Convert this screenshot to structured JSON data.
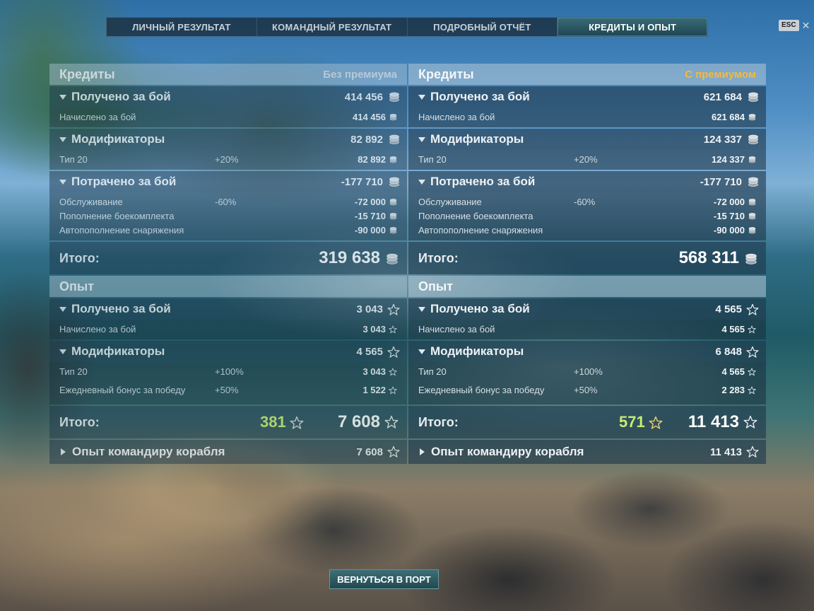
{
  "tabs": [
    {
      "label": "ЛИЧНЫЙ РЕЗУЛЬТАТ"
    },
    {
      "label": "КОМАНДНЫЙ РЕЗУЛЬТАТ"
    },
    {
      "label": "ПОДРОБНЫЙ ОТЧЁТ"
    },
    {
      "label": "КРЕДИТЫ И ОПЫТ",
      "active": true
    }
  ],
  "esc": {
    "key": "ESC",
    "close": "✕"
  },
  "icons": {
    "coin": "coin-icon",
    "star": "star-icon"
  },
  "colors": {
    "premium": "#f6b93b",
    "bonus_xp": "#c8ec70"
  },
  "left": {
    "credits": {
      "title": "Кредиты",
      "subtitle": "Без премиума",
      "earned": {
        "label": "Получено за бой",
        "value": "414 456",
        "rows": [
          {
            "label": "Начислено за бой",
            "pct": "",
            "value": "414 456"
          }
        ]
      },
      "modifiers": {
        "label": "Модификаторы",
        "value": "82 892",
        "rows": [
          {
            "label": "Тип 20",
            "pct": "+20%",
            "value": "82 892"
          }
        ]
      },
      "spent": {
        "label": "Потрачено за бой",
        "value": "-177 710",
        "rows": [
          {
            "label": "Обслуживание",
            "pct": "-60%",
            "value": "-72 000"
          },
          {
            "label": "Пополнение боекомплекта",
            "pct": "",
            "value": "-15 710"
          },
          {
            "label": "Автопополнение снаряжения",
            "pct": "",
            "value": "-90 000"
          }
        ]
      },
      "total": {
        "label": "Итого:",
        "value": "319 638"
      }
    },
    "xp": {
      "title": "Опыт",
      "earned": {
        "label": "Получено за бой",
        "value": "3 043",
        "rows": [
          {
            "label": "Начислено за бой",
            "pct": "",
            "value": "3 043"
          }
        ]
      },
      "modifiers": {
        "label": "Модификаторы",
        "value": "4 565",
        "rows": [
          {
            "label": "Тип 20",
            "pct": "+100%",
            "value": "3 043"
          },
          {
            "label": "Ежедневный бонус за победу",
            "pct": "+50%",
            "value": "1 522"
          }
        ]
      },
      "total": {
        "label": "Итого:",
        "bonus": "381",
        "value": "7 608"
      },
      "commander": {
        "label": "Опыт командиру корабля",
        "value": "7 608"
      }
    }
  },
  "right": {
    "credits": {
      "title": "Кредиты",
      "subtitle": "С премиумом",
      "earned": {
        "label": "Получено за бой",
        "value": "621 684",
        "rows": [
          {
            "label": "Начислено за бой",
            "pct": "",
            "value": "621 684"
          }
        ]
      },
      "modifiers": {
        "label": "Модификаторы",
        "value": "124 337",
        "rows": [
          {
            "label": "Тип 20",
            "pct": "+20%",
            "value": "124 337"
          }
        ]
      },
      "spent": {
        "label": "Потрачено за бой",
        "value": "-177 710",
        "rows": [
          {
            "label": "Обслуживание",
            "pct": "-60%",
            "value": "-72 000"
          },
          {
            "label": "Пополнение боекомплекта",
            "pct": "",
            "value": "-15 710"
          },
          {
            "label": "Автопополнение снаряжения",
            "pct": "",
            "value": "-90 000"
          }
        ]
      },
      "total": {
        "label": "Итого:",
        "value": "568 311"
      }
    },
    "xp": {
      "title": "Опыт",
      "earned": {
        "label": "Получено за бой",
        "value": "4 565",
        "rows": [
          {
            "label": "Начислено за бой",
            "pct": "",
            "value": "4 565"
          }
        ]
      },
      "modifiers": {
        "label": "Модификаторы",
        "value": "6 848",
        "rows": [
          {
            "label": "Тип 20",
            "pct": "+100%",
            "value": "4 565"
          },
          {
            "label": "Ежедневный бонус за победу",
            "pct": "+50%",
            "value": "2 283"
          }
        ]
      },
      "total": {
        "label": "Итого:",
        "bonus": "571",
        "value": "11 413"
      },
      "commander": {
        "label": "Опыт командиру корабля",
        "value": "11 413"
      }
    }
  },
  "footer": {
    "return_button": "ВЕРНУТЬСЯ В ПОРТ"
  }
}
